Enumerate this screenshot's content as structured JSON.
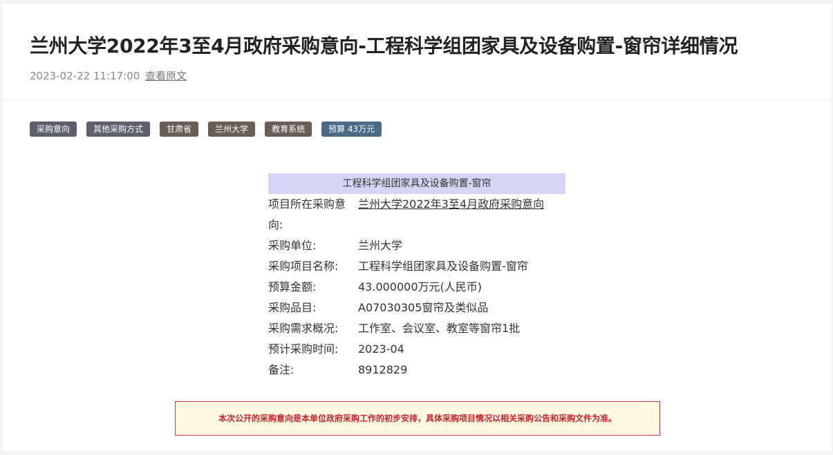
{
  "article": {
    "title": "兰州大学2022年3至4月政府采购意向-工程科学组团家具及设备购置-窗帘详细情况",
    "timestamp": "2023-02-22 11:17:00",
    "view_original": "查看原文"
  },
  "tags": [
    "采购意向",
    "其他采购方式",
    "甘肃省",
    "兰州大学",
    "教育系统",
    "预算 43万元"
  ],
  "colors": {
    "tag_gray": "#5b606b",
    "tag_brown": "#6a5d55",
    "tag_blue": "#4a6a86",
    "header_bg": "#d5d5f5",
    "notice_text": "#c8242f"
  },
  "card": {
    "header": "工程科学组团家具及设备购置-窗帘",
    "rows": [
      {
        "label": "项目所在采购意向:",
        "value": "兰州大学2022年3至4月政府采购意向"
      },
      {
        "label": "采购单位:",
        "value": "兰州大学"
      },
      {
        "label": "采购项目名称:",
        "value": "工程科学组团家具及设备购置-窗帘"
      },
      {
        "label": "预算金额:",
        "value": "43.000000万元(人民币)"
      },
      {
        "label": "采购品目:",
        "value": "A07030305窗帘及类似品"
      },
      {
        "label": "采购需求概况:",
        "value": "工作室、会议室、教室等窗帘1批"
      },
      {
        "label": "预计采购时间:",
        "value": "2023-04"
      },
      {
        "label": "备注:",
        "value": "8912829"
      }
    ]
  },
  "notice": "本次公开的采购意向是本单位政府采购工作的初步安排，具体采购项目情况以相关采购公告和采购文件为准。"
}
